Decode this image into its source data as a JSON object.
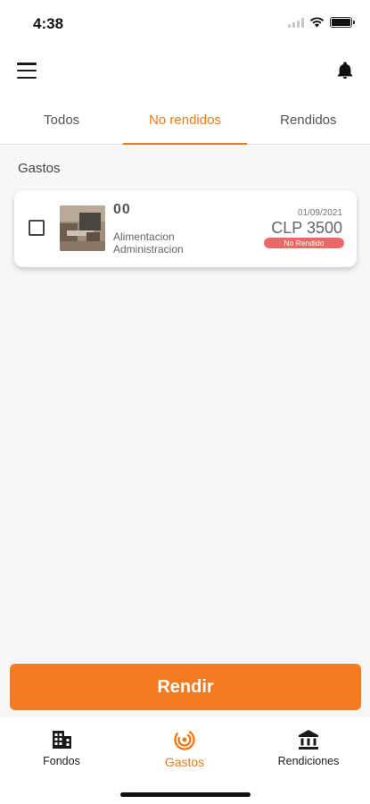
{
  "status_bar": {
    "time": "4:38"
  },
  "header": {
    "menu_icon": "hamburger-menu-icon",
    "notification_icon": "bell-icon"
  },
  "tabs": [
    {
      "label": "Todos",
      "active": false
    },
    {
      "label": "No rendidos",
      "active": true
    },
    {
      "label": "Rendidos",
      "active": false
    }
  ],
  "section": {
    "title": "Gastos"
  },
  "expenses": [
    {
      "name": "00",
      "category": "Alimentacion",
      "department": "Administracion",
      "date": "01/09/2021",
      "amount": "CLP 3500",
      "status": "No Rendido",
      "checked": false
    }
  ],
  "action": {
    "button_label": "Rendir"
  },
  "bottom_nav": [
    {
      "label": "Fondos",
      "icon": "building-icon",
      "active": false
    },
    {
      "label": "Gastos",
      "icon": "target-icon",
      "active": true
    },
    {
      "label": "Rendiciones",
      "icon": "bank-icon",
      "active": false
    }
  ],
  "colors": {
    "accent": "#ef7a1c",
    "button": "#f57b20",
    "badge": "#ee6767"
  }
}
